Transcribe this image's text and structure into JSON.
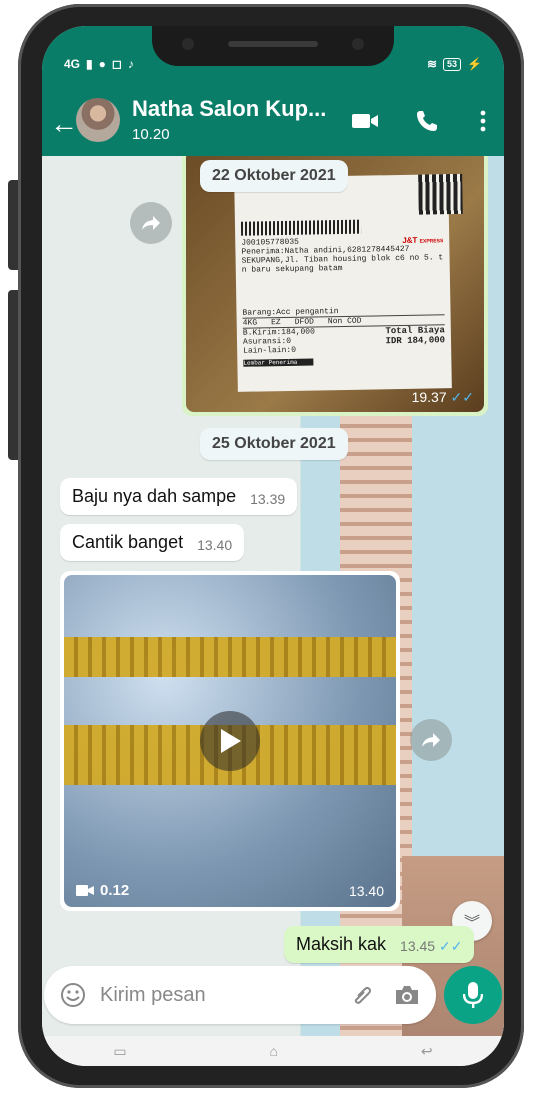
{
  "status_bar": {
    "network": "4G",
    "battery": "53"
  },
  "header": {
    "title": "Natha Salon Kup...",
    "subtitle": "10.20"
  },
  "messages": {
    "date1": "22 Oktober 2021",
    "receipt": {
      "time": "19.37",
      "code": "J00105778035",
      "brand": "J&T",
      "brand_sub": "EXPRESS",
      "line1": "Penerima:Natha andini,6281278445427",
      "line2": "SEKUPANG,Jl. Tiban housing blok c6 no 5. tiba",
      "line3": "n baru sekupang batam",
      "item": "Barang:Acc pengantin",
      "weight": "4KG",
      "service": "EZ",
      "dfod": "DFOD",
      "cod": "Non COD",
      "bkirim": "B.Kirim:184,000",
      "asuransi": "Asuransi:0",
      "lain": "Lain-lain:0",
      "total_label": "Total Biaya",
      "total": "IDR 184,000",
      "footer": "Lembar Penerima"
    },
    "date2": "25 Oktober 2021",
    "m1": {
      "text": "Baju nya dah sampe",
      "time": "13.39"
    },
    "m2": {
      "text": "Cantik banget",
      "time": "13.40"
    },
    "video": {
      "duration": "0.12",
      "time": "13.40"
    },
    "m3": {
      "text": "Maksih kak",
      "time": "13.45"
    }
  },
  "input": {
    "placeholder": "Kirim pesan"
  },
  "colors": {
    "header": "#0a7d68",
    "accent": "#0aa386",
    "outgoing": "#d9f8c6",
    "tick": "#4fb6ec"
  }
}
